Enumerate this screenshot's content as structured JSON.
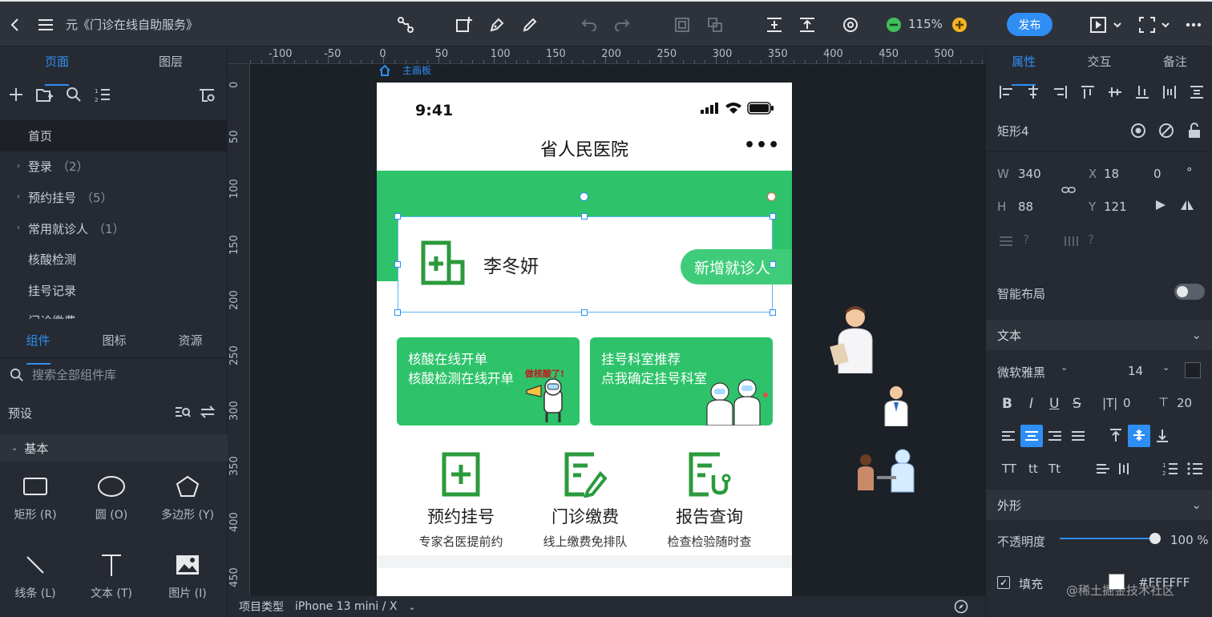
{
  "toolbar": {
    "title": "元《门诊在线自助服务》",
    "zoom": "115%",
    "publish_label": "发布"
  },
  "left": {
    "page_tabs": [
      "页面",
      "图层"
    ],
    "pages": [
      {
        "label": "首页",
        "count": "",
        "expandable": false
      },
      {
        "label": "登录",
        "count": "（2）",
        "expandable": true
      },
      {
        "label": "预约挂号",
        "count": "（5）",
        "expandable": true
      },
      {
        "label": "常用就诊人",
        "count": "（1）",
        "expandable": true
      },
      {
        "label": "核酸检测",
        "count": "",
        "expandable": false
      },
      {
        "label": "挂号记录",
        "count": "",
        "expandable": false
      },
      {
        "label": "门诊缴费",
        "count": "",
        "expandable": false
      }
    ],
    "comp_tabs": [
      "组件",
      "图标",
      "资源"
    ],
    "search_placeholder": "搜索全部组件库",
    "preset_label": "预设",
    "basic_label": "基本",
    "components": [
      {
        "label": "矩形 (R)",
        "icon": "rectangle-icon"
      },
      {
        "label": "圆 (O)",
        "icon": "circle-icon"
      },
      {
        "label": "多边形 (Y)",
        "icon": "polygon-icon"
      },
      {
        "label": "线条 (L)",
        "icon": "line-icon"
      },
      {
        "label": "文本 (T)",
        "icon": "text-icon"
      },
      {
        "label": "图片 (I)",
        "icon": "image-icon"
      }
    ]
  },
  "canvas": {
    "ruler_h": [
      "-100",
      "-50",
      "0",
      "50",
      "100",
      "150",
      "200",
      "250",
      "300",
      "350",
      "400",
      "450",
      "500"
    ],
    "ruler_v": [
      "0",
      "50",
      "100",
      "150",
      "200",
      "250",
      "300",
      "350",
      "400",
      "450"
    ],
    "artboard_label": "主画板",
    "phone": {
      "time": "9:41",
      "title": "省人民医院",
      "more": "•••",
      "patient_name": "李冬妍",
      "add_patient": "新增就诊人",
      "banners": [
        {
          "line1": "核酸在线开单",
          "line2": "核酸检测在线开单",
          "tag": "做核酸了!"
        },
        {
          "line1": "挂号科室推荐",
          "line2": "点我确定挂号科室",
          "tag": ""
        }
      ],
      "services": [
        {
          "title": "预约挂号",
          "sub": "专家名医提前约",
          "icon": "register-icon"
        },
        {
          "title": "门诊缴费",
          "sub": "线上缴费免排队",
          "icon": "payment-icon"
        },
        {
          "title": "报告查询",
          "sub": "检查检验随时查",
          "icon": "report-icon"
        }
      ]
    }
  },
  "bottombar": {
    "project_type_label": "项目类型",
    "device": "iPhone 13 mini / X"
  },
  "right": {
    "tabs": [
      "属性",
      "交互",
      "备注"
    ],
    "element_name": "矩形4",
    "w_label": "W",
    "w": "340",
    "h_label": "H",
    "h": "88",
    "x_label": "X",
    "x": "18",
    "y_label": "Y",
    "y": "121",
    "rotation": "0",
    "rotation_unit": "°",
    "smart_layout_label": "智能布局",
    "text_section": "文本",
    "font_family": "微软雅黑",
    "font_size": "14",
    "letter_spacing": "0",
    "line_height": "20",
    "appearance_section": "外形",
    "opacity_label": "不透明度",
    "opacity": "100 %",
    "fill_label": "填充",
    "fill_color": "#FFFFFF",
    "watermark": "@稀土掘金技术社区"
  },
  "colors": {
    "accent": "#2f8ef4",
    "green": "#2ec36a",
    "dark_green": "#2b9a3c"
  }
}
